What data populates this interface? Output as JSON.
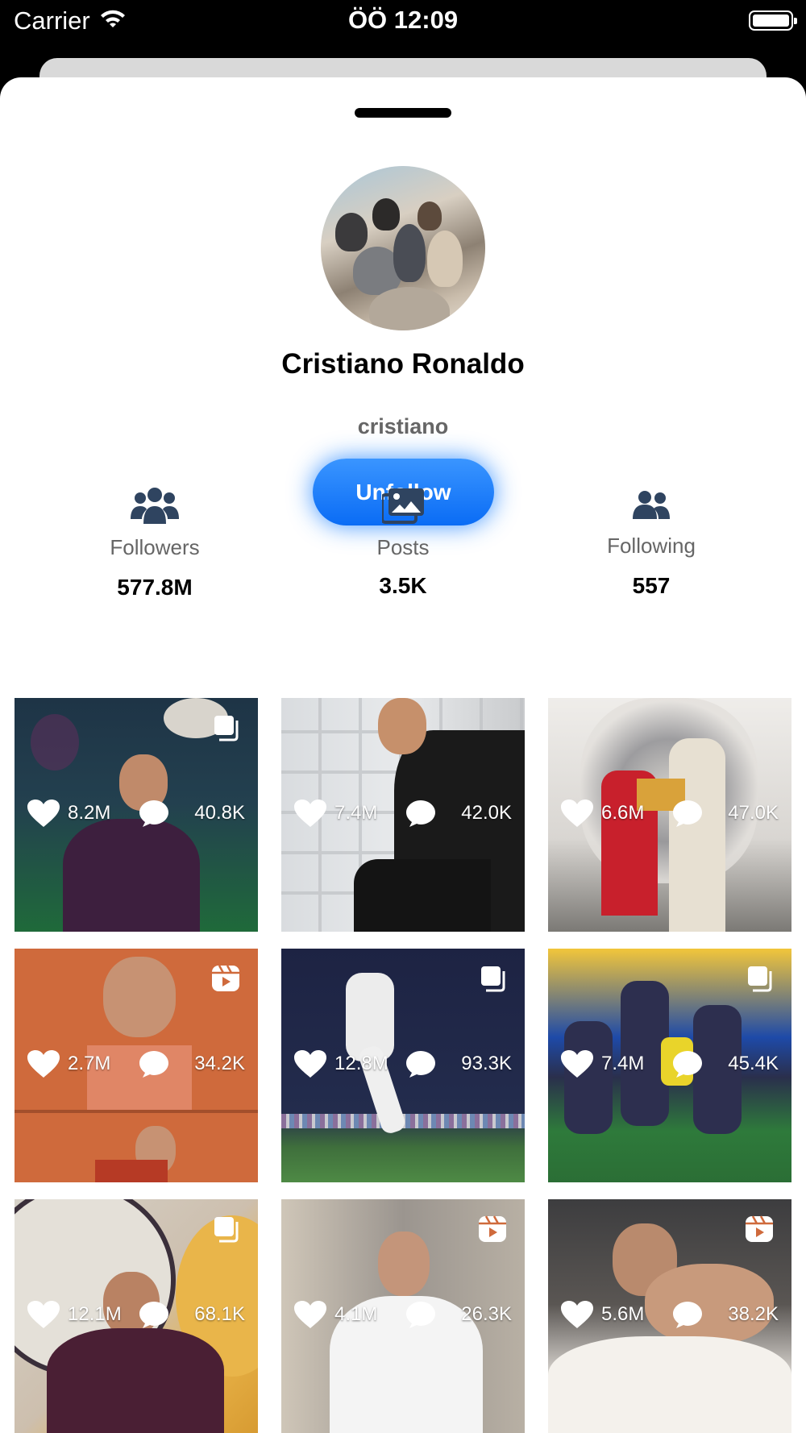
{
  "status_bar": {
    "carrier": "Carrier",
    "time": "ÖÖ 12:09"
  },
  "profile": {
    "name": "Cristiano Ronaldo",
    "username": "cristiano",
    "follow_button": "Unfollow"
  },
  "stats": [
    {
      "label": "Followers",
      "value": "577.8M",
      "icon": "users-group-icon"
    },
    {
      "label": "Posts",
      "value": "3.5K",
      "icon": "images-icon"
    },
    {
      "label": "Following",
      "value": "557",
      "icon": "user-friends-icon"
    }
  ],
  "posts": [
    {
      "likes": "8.2M",
      "comments": "40.8K",
      "type": "carousel"
    },
    {
      "likes": "7.4M",
      "comments": "42.0K",
      "type": "image"
    },
    {
      "likes": "6.6M",
      "comments": "47.0K",
      "type": "image"
    },
    {
      "likes": "2.7M",
      "comments": "34.2K",
      "type": "reel"
    },
    {
      "likes": "12.8M",
      "comments": "93.3K",
      "type": "carousel"
    },
    {
      "likes": "7.4M",
      "comments": "45.4K",
      "type": "carousel"
    },
    {
      "likes": "12.1M",
      "comments": "68.1K",
      "type": "carousel"
    },
    {
      "likes": "4.1M",
      "comments": "26.3K",
      "type": "reel"
    },
    {
      "likes": "5.6M",
      "comments": "38.2K",
      "type": "reel"
    }
  ],
  "colors": {
    "accent": "#0a6cf5",
    "stat_icon": "#2f4460"
  }
}
